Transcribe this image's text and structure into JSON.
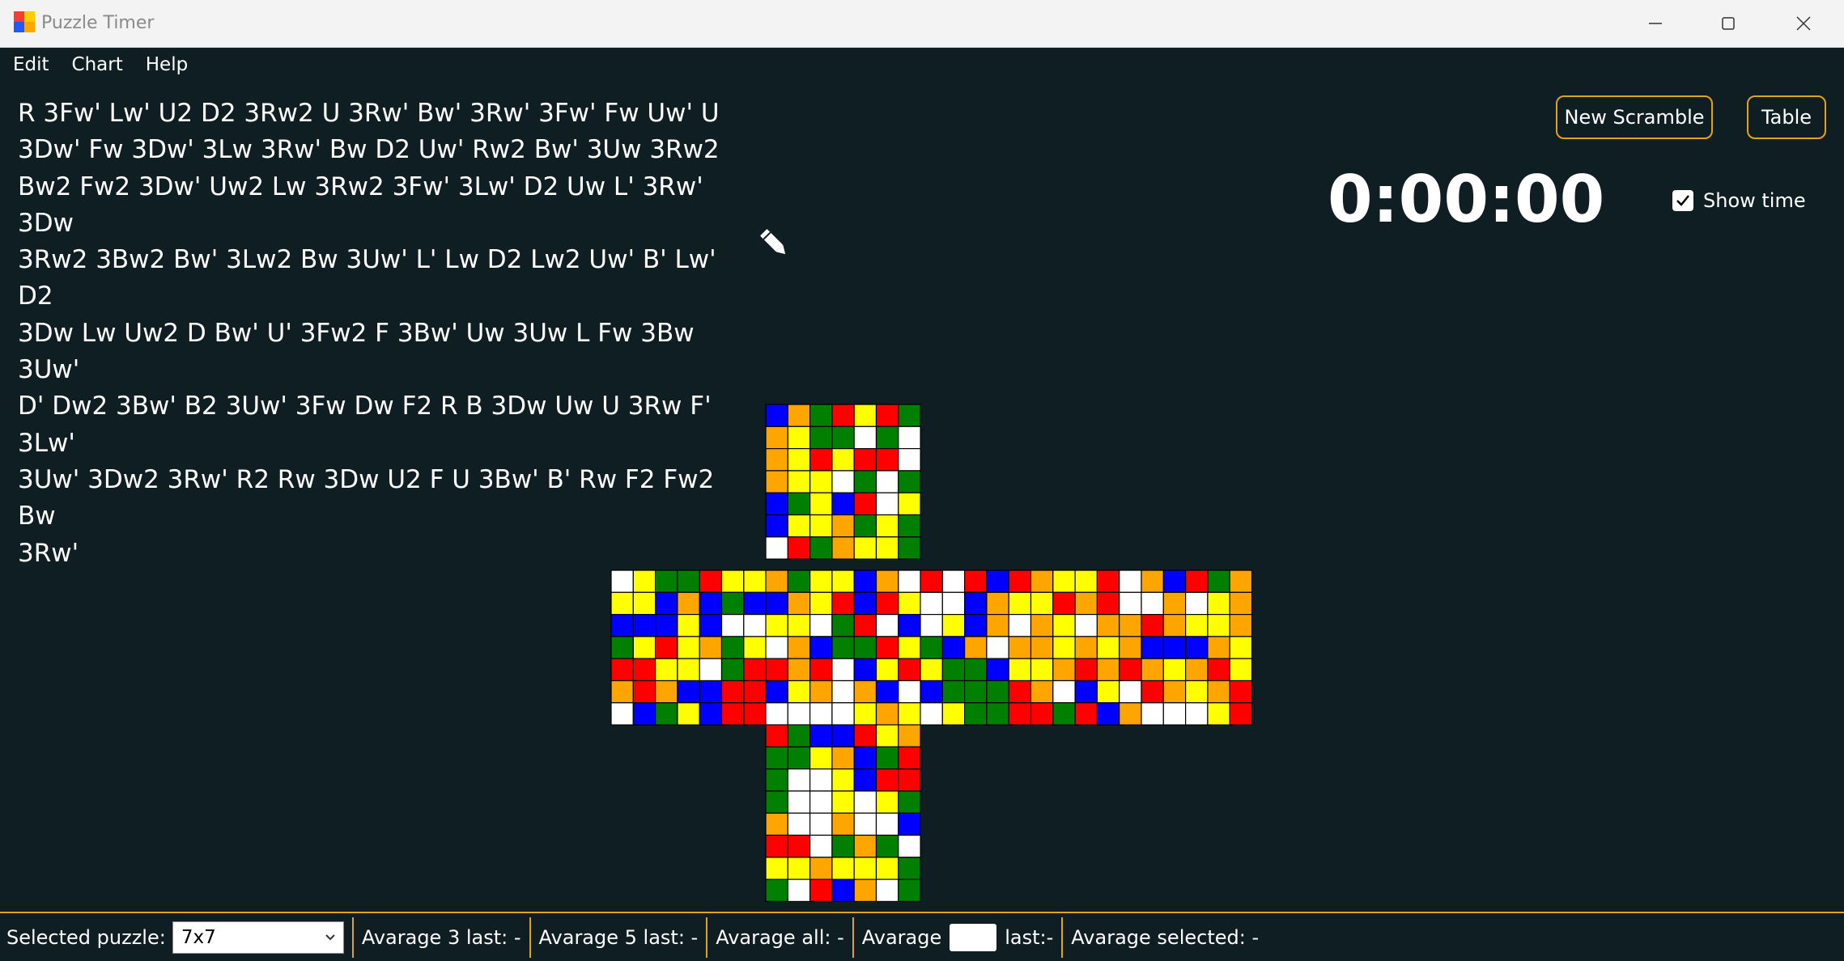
{
  "window": {
    "title": "Puzzle Timer",
    "controls": [
      "minimize",
      "maximize",
      "close"
    ]
  },
  "menu": {
    "items": [
      "Edit",
      "Chart",
      "Help"
    ]
  },
  "scramble": {
    "lines": [
      "R 3Fw' Lw' U2 D2 3Rw2 U 3Rw' Bw' 3Rw' 3Fw' Fw Uw' U",
      "3Dw' Fw 3Dw' 3Lw 3Rw' Bw D2 Uw' Rw2 Bw' 3Uw 3Rw2",
      "Bw2 Fw2 3Dw' Uw2 Lw 3Rw2 3Fw' 3Lw' D2 Uw L' 3Rw' 3Dw",
      "3Rw2 3Bw2 Bw' 3Lw2 Bw 3Uw' L' Lw D2 Lw2 Uw' B' Lw' D2",
      "3Dw Lw Uw2 D Bw' U' 3Fw2 F 3Bw' Uw 3Uw L Fw 3Bw 3Uw'",
      "D' Dw2 3Bw' B2 3Uw' 3Fw Dw F2 R B 3Dw Uw U 3Rw F' 3Lw'",
      "3Uw' 3Dw2 3Rw' R2 Rw 3Dw U2 F U 3Bw' B' Rw F2 Fw2 Bw",
      "3Rw'"
    ],
    "edit_icon": "pencil-icon"
  },
  "buttons": {
    "new_scramble": "New Scramble",
    "table": "Table"
  },
  "timer": {
    "display": "0:00:00",
    "show_time_label": "Show time",
    "show_time_checked": true
  },
  "status_bar": {
    "selected_puzzle_label": "Selected puzzle:",
    "selected_puzzle_value": "7x7",
    "avg3": "Avarage 3 last: -",
    "avg5": "Avarage 5 last: -",
    "avg_all": "Avarage all: -",
    "avg_n_prefix": "Avarage",
    "avg_n_value": "",
    "avg_n_suffix": "last:-",
    "avg_selected": "Avarage  selected:  -"
  },
  "cube": {
    "puzzle": "7x7",
    "palette": {
      "W": "#ffffff",
      "Y": "#ffff00",
      "R": "#ff0000",
      "O": "#ffa500",
      "B": "#0000ff",
      "G": "#007f00"
    },
    "faces": {
      "U": [
        "BOGRYRG",
        "OYGGWGW",
        "OYRYRRW",
        "OYYWGWG",
        "BGYBRWY",
        "BYYOGYG",
        "WRGOYYG"
      ],
      "L": [
        "WYGGRYY",
        "YYBOBGB",
        "BBBYBWW",
        "GYRYOGY",
        "RRYYWGR",
        "OROBBRR",
        "WBGYBRR"
      ],
      "F": [
        "OGYYBOW",
        "BOYRBRY",
        "YYWGRWB",
        "WOBGGRY",
        "RORWBYR",
        "BYOWOBW",
        "WWWWYOY"
      ],
      "R": [
        "RWRBROYYRWOBRGO",
        "WWBOYYRORWWOWYO",
        "WYBOWOYWOOROYYO",
        "GBOWOOYOYOBBBOY",
        "YGGBYYOROROYORY",
        "BGGGROWBYWROYOR",
        "WYGGRRGRBOWWWYR"
      ],
      "D": [
        "RGBBRYO",
        "GGYOBGR",
        "GWWYBRR",
        "GWWYWYG",
        "OWWOWWB",
        "RRWGOGW",
        "YYOYYYG",
        "GWRBOWG"
      ]
    }
  }
}
